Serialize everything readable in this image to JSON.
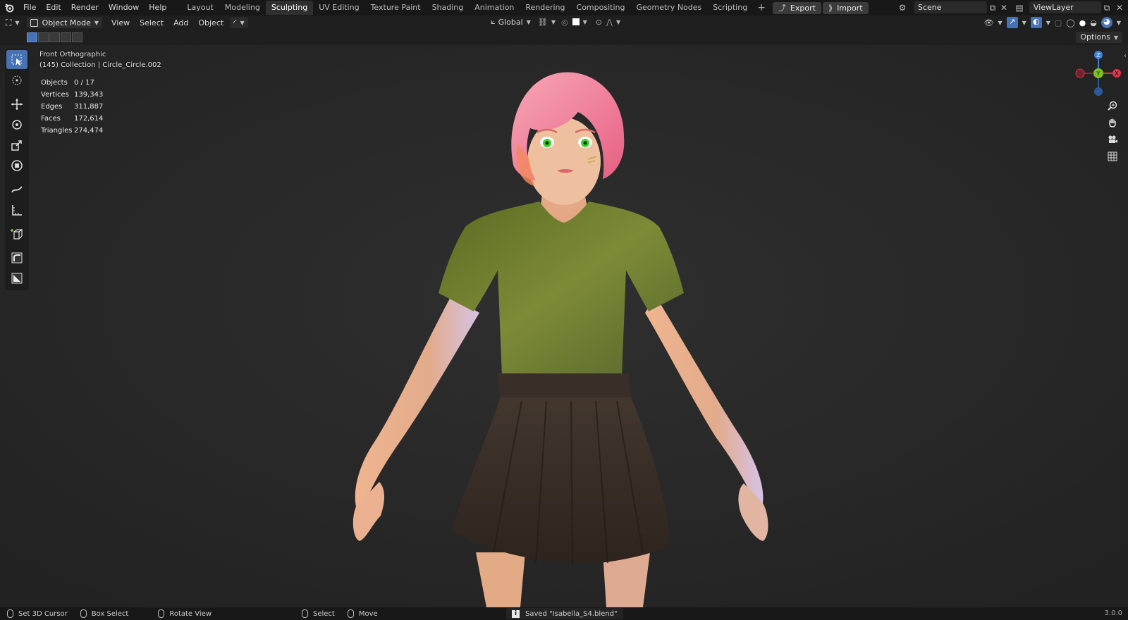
{
  "menu": {
    "items": [
      "File",
      "Edit",
      "Render",
      "Window",
      "Help"
    ]
  },
  "workspaces": {
    "tabs": [
      "Layout",
      "Modeling",
      "Sculpting",
      "UV Editing",
      "Texture Paint",
      "Shading",
      "Animation",
      "Rendering",
      "Compositing",
      "Geometry Nodes",
      "Scripting"
    ],
    "active_index": 2,
    "plus": "+"
  },
  "addon": {
    "export_label": "Export",
    "import_label": "Import"
  },
  "scene": {
    "name": "Scene",
    "view_layer": "ViewLayer"
  },
  "header": {
    "mode": "Object Mode",
    "menus": [
      "View",
      "Select",
      "Add",
      "Object"
    ],
    "transform_orientation": "Global",
    "options_label": "Options"
  },
  "viewport": {
    "view_name": "Front Orthographic",
    "collection_line": "(145) Collection | Circle_Circle.002",
    "stats": [
      {
        "label": "Objects",
        "value": "0 / 17"
      },
      {
        "label": "Vertices",
        "value": "139,343"
      },
      {
        "label": "Edges",
        "value": "311,887"
      },
      {
        "label": "Faces",
        "value": "172,614"
      },
      {
        "label": "Triangles",
        "value": "274,474"
      }
    ],
    "gizmo": {
      "z": "Z",
      "y": "Y",
      "x": "X"
    }
  },
  "colors": {
    "accent": "#4772b3",
    "axis_x": "#e0334a",
    "axis_y": "#7fc021",
    "axis_z": "#3c7fd6",
    "shirt": "#6b7a2e",
    "skirt": "#3d3128",
    "hair": "#ef8fa6",
    "skin": "#e7b592"
  },
  "statusbar": {
    "set_cursor": "Set 3D Cursor",
    "box_select": "Box Select",
    "rotate_view": "Rotate View",
    "select": "Select",
    "move": "Move",
    "saved_message": "Saved \"Isabella_S4.blend\"",
    "version": "3.0.0"
  }
}
